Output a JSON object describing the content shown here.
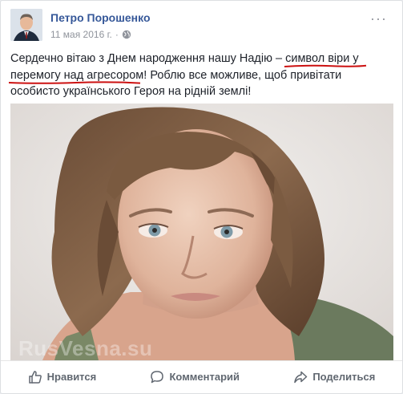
{
  "post": {
    "author": "Петро Порошенко",
    "date": "11 мая 2016 г.",
    "separator": "·",
    "more": "···",
    "text": {
      "p1": "Сердечно вітаю з Днем народження нашу Надію – ",
      "u1": "символ віри у",
      "u2": "перемогу над агресором",
      "p2": "! Роблю все можливе, щоб привітати особисто українського Героя на рідній землі!"
    },
    "watermark": "RusVesna.su"
  },
  "actions": {
    "like": "Нравится",
    "comment": "Комментарий",
    "share": "Поделиться"
  },
  "icons": {
    "privacy": "globe-icon",
    "like": "thumbs-up-icon",
    "comment": "comment-icon",
    "share": "share-icon",
    "more": "more-icon"
  },
  "colors": {
    "author": "#365899",
    "underline": "#cc1111",
    "action_text": "#606770"
  }
}
